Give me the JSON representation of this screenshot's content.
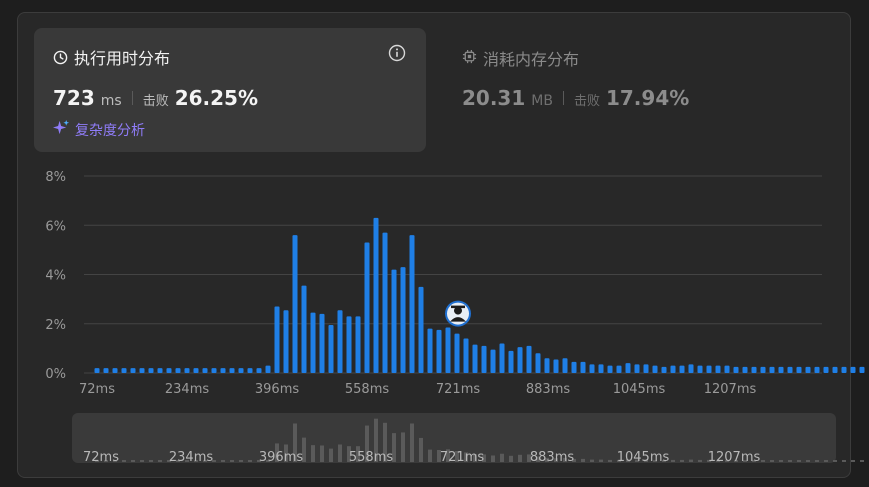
{
  "runtime_card": {
    "title": "执行用时分布",
    "value": "723",
    "unit": "ms",
    "beats_label": "击败",
    "beats_value": "26.25%",
    "complexity_label": "复杂度分析"
  },
  "memory_card": {
    "title": "消耗内存分布",
    "value": "20.31",
    "unit": "MB",
    "beats_label": "击败",
    "beats_value": "17.94%"
  },
  "colors": {
    "bar": "#1f7fe6",
    "grid": "#444444",
    "mini_bar": "#5a5a5a",
    "accent_purple": "#8f7cf7"
  },
  "chart_data": {
    "type": "bar",
    "ylabel": "",
    "xlabel": "",
    "ylim": [
      0,
      8
    ],
    "yticks": [
      "8%",
      "6%",
      "4%",
      "2%",
      "0%"
    ],
    "ytick_values": [
      8,
      6,
      4,
      2,
      0
    ],
    "xtick_labels": [
      "72ms",
      "234ms",
      "396ms",
      "558ms",
      "721ms",
      "883ms",
      "1045ms",
      "1207ms"
    ],
    "values": [
      0.2,
      0.2,
      0.2,
      0.2,
      0.2,
      0.2,
      0.2,
      0.2,
      0.2,
      0.2,
      0.2,
      0.2,
      0.2,
      0.2,
      0.2,
      0.2,
      0.2,
      0.2,
      0.2,
      0.3,
      2.7,
      2.55,
      5.6,
      3.55,
      2.45,
      2.4,
      1.95,
      2.55,
      2.3,
      2.3,
      5.3,
      6.3,
      5.7,
      4.2,
      4.3,
      5.6,
      3.5,
      1.8,
      1.75,
      1.85,
      1.6,
      1.4,
      1.15,
      1.1,
      0.95,
      1.2,
      0.9,
      1.05,
      1.1,
      0.8,
      0.6,
      0.55,
      0.6,
      0.45,
      0.45,
      0.35,
      0.35,
      0.3,
      0.3,
      0.4,
      0.35,
      0.35,
      0.3,
      0.25,
      0.3,
      0.3,
      0.35,
      0.3,
      0.3,
      0.3,
      0.3,
      0.25,
      0.25,
      0.25,
      0.25,
      0.25,
      0.25,
      0.25,
      0.25,
      0.25,
      0.25,
      0.25,
      0.25,
      0.25,
      0.25,
      0.25
    ],
    "highlight_index": 40,
    "grid": true
  }
}
